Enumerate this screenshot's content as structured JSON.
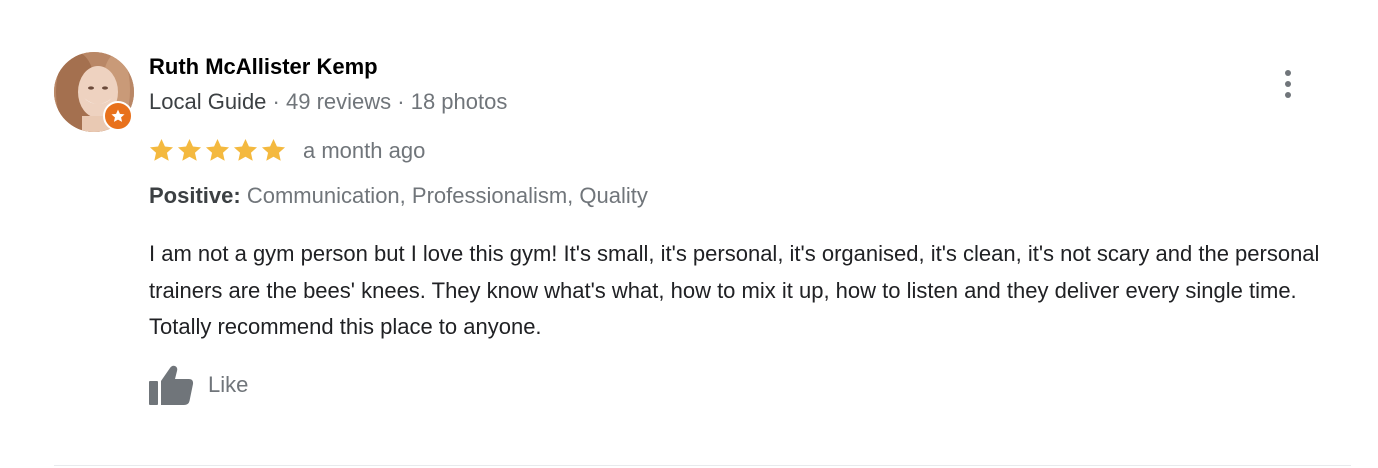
{
  "reviewer": {
    "name": "Ruth McAllister Kemp",
    "guide_label": "Local Guide",
    "separator": " · ",
    "reviews": "49 reviews",
    "photos": "18 photos",
    "badge_icon": "local-guide-star-icon",
    "badge_color": "#e8711c"
  },
  "review": {
    "rating": 5,
    "max_rating": 5,
    "star_color": "#f4b93f",
    "date": "a month ago",
    "attributes_label": "Positive:",
    "attributes_values": "Communication, Professionalism, Quality",
    "text": "I am not a gym person but I love this gym! It's small, it's personal, it's organised, it's clean, it's not scary and the personal trainers are the bees' knees. They know what's what, how to mix it up, how to listen and they deliver every single time. Totally recommend this place to anyone."
  },
  "actions": {
    "like_label": "Like",
    "like_icon": "thumbs-up-icon",
    "menu_icon": "more-vertical-icon"
  }
}
